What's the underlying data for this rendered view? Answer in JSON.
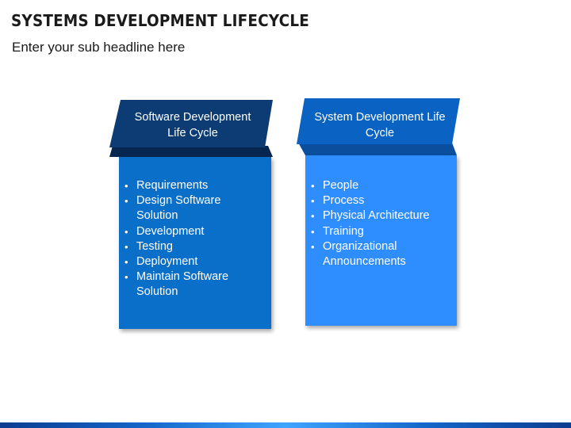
{
  "slide": {
    "title": "SYSTEMS DEVELOPMENT LIFECYCLE",
    "subtitle": "Enter your sub headline here"
  },
  "cards": [
    {
      "header": [
        "Software Development",
        "Life Cycle"
      ],
      "items": [
        "Requirements",
        "Design Software",
        "Solution",
        "Development",
        "Testing",
        "Deployment",
        "Maintain Software",
        "Solution"
      ],
      "colors": {
        "header": "#0d3b73",
        "ribbon": "#06264f",
        "body": "#0a6fc9"
      }
    },
    {
      "header": [
        "System Development Life",
        "Cycle"
      ],
      "items": [
        "People",
        "Process",
        "Physical Architecture",
        "Training",
        "Organizational",
        "Announcements"
      ],
      "colors": {
        "header": "#0a63c2",
        "ribbon": "#0a4e9e",
        "body": "#2f8eff"
      }
    }
  ]
}
